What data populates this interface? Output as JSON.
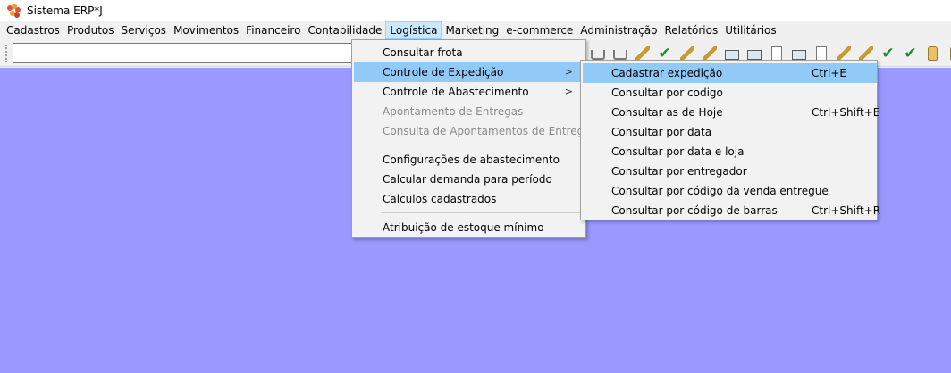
{
  "window": {
    "title": "Sistema ERP*J",
    "icon": "app-logo-icon"
  },
  "menubar": {
    "items": [
      {
        "label": "Cadastros"
      },
      {
        "label": "Produtos"
      },
      {
        "label": "Serviços"
      },
      {
        "label": "Movimentos"
      },
      {
        "label": "Financeiro"
      },
      {
        "label": "Contabilidade"
      },
      {
        "label": "Logística",
        "open": true
      },
      {
        "label": "Marketing"
      },
      {
        "label": "e-commerce"
      },
      {
        "label": "Administração"
      },
      {
        "label": "Relatórios"
      },
      {
        "label": "Utilitários"
      }
    ]
  },
  "toolbar": {
    "search": {
      "value": "",
      "placeholder": ""
    },
    "icons": [
      "cart-icon",
      "cart-icon",
      "edit-icon",
      "check-icon",
      "edit-icon",
      "edit-icon",
      "screen-icon",
      "screen-icon",
      "calendar-icon",
      "screen-icon",
      "lock-icon",
      "gift-icon",
      "gift-icon",
      "check-icon",
      "check-icon",
      "bottle-icon",
      "bottle-icon"
    ]
  },
  "logistica_menu": {
    "items": [
      {
        "label": "Consultar frota"
      },
      {
        "label": "Controle de Expedição",
        "submenu": true,
        "highlighted": true
      },
      {
        "label": "Controle de Abastecimento",
        "submenu": true
      },
      {
        "label": "Apontamento de Entregas",
        "disabled": true
      },
      {
        "label": "Consulta de Apontamentos de Entregas",
        "disabled": true
      },
      {
        "label": "Configurações de abastecimento"
      },
      {
        "label": "Calcular demanda para período"
      },
      {
        "label": "Calculos cadastrados"
      },
      {
        "label": "Atribuição de estoque mínimo"
      }
    ],
    "arrow": ">"
  },
  "expedicao_menu": {
    "items": [
      {
        "label": "Cadastrar expedição",
        "shortcut": "Ctrl+E",
        "highlighted": true
      },
      {
        "label": "Consultar por codigo",
        "shortcut": ""
      },
      {
        "label": "Consultar as de Hoje",
        "shortcut": "Ctrl+Shift+E"
      },
      {
        "label": "Consultar por data",
        "shortcut": ""
      },
      {
        "label": "Consultar por data e loja",
        "shortcut": ""
      },
      {
        "label": "Consultar por entregador",
        "shortcut": ""
      },
      {
        "label": "Consultar por código da venda entregue",
        "shortcut": ""
      },
      {
        "label": "Consultar por código de barras",
        "shortcut": "Ctrl+Shift+R"
      }
    ]
  },
  "colors": {
    "workspace": "#9999ff",
    "menu_highlight": "#91c9f7",
    "menubar_open": "#cce8ff"
  }
}
